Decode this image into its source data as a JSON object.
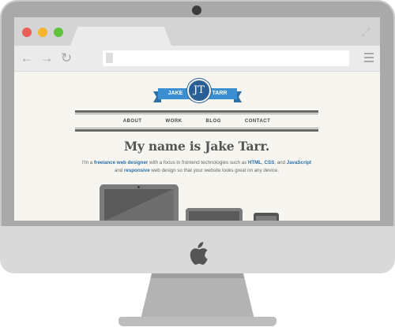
{
  "browser": {
    "traffic_lights": [
      "#ec5f57",
      "#f5b52e",
      "#5fc23b"
    ],
    "icons": [
      "back-arrow-icon",
      "forward-arrow-icon",
      "reload-icon",
      "page-icon",
      "menu-icon",
      "expand-icon"
    ]
  },
  "logo": {
    "left": "JAKE",
    "monogram": "JT",
    "right": "TARR",
    "color": "#3b8ed1"
  },
  "nav": {
    "items": [
      "ABOUT",
      "WORK",
      "BLOG",
      "CONTACT"
    ]
  },
  "hero": {
    "headline": "My name is Jake Tarr.",
    "intro_1": "I'm a ",
    "intro_2": "freelance web designer",
    "intro_3": " with a focus in frontend technologies such as ",
    "intro_4": "HTML",
    "intro_5": ", ",
    "intro_6": "CSS",
    "intro_7": ", and ",
    "intro_8": "JavaScript",
    "intro_9": " and ",
    "intro_10": "responsive",
    "intro_11": " web design so that your website looks great on any device."
  },
  "devices": [
    "laptop",
    "tablet",
    "phone"
  ]
}
